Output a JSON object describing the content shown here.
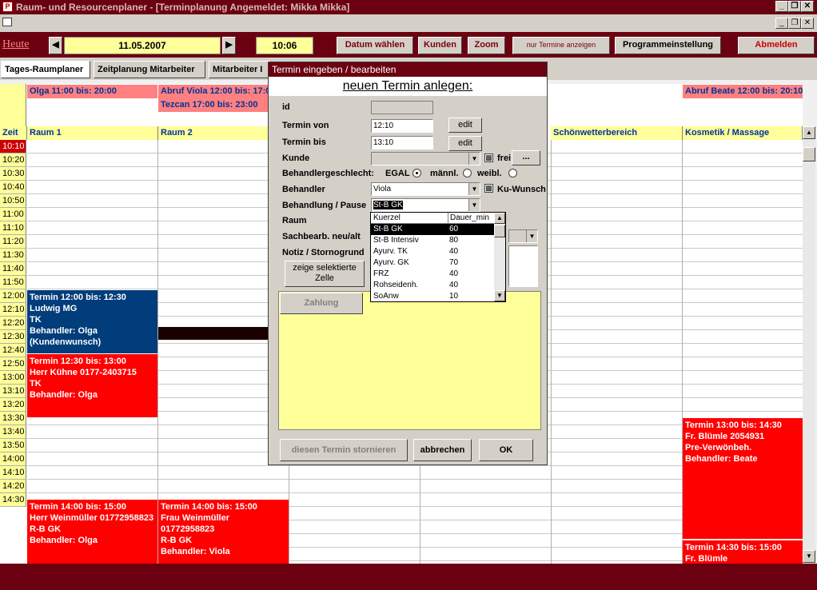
{
  "window": {
    "title": "Raum- und Resourcenplaner - [Terminplanung Angemeldet: Mikka Mikka]"
  },
  "toolbar": {
    "heute": "Heute",
    "date": "11.05.2007",
    "time": "10:06",
    "datum_waehlen": "Datum wählen",
    "kunden": "Kunden",
    "zoom": "Zoom",
    "nur_termine": "nur Termine anzeigen",
    "programmeinstellung": "Programmeinstellung",
    "abmelden": "Abmelden"
  },
  "tabs": [
    "Tages-Raumplaner",
    "Zeitplanung Mitarbeiter",
    "Mitarbeiter I"
  ],
  "top_rows": {
    "olga": "Olga 11:00 bis: 20:00",
    "viola": "Abruf Viola 12:00 bis: 17:00",
    "tezcan": "Tezcan 17:00 bis: 23:00",
    "beate": "Abruf Beate 12:00 bis: 20:10"
  },
  "columns": {
    "zeit": "Zeit",
    "raum1": "Raum 1",
    "raum2": "Raum 2",
    "schoen": "Schönwetterbereich",
    "kosmetik": "Kosmetik / Massage"
  },
  "times": [
    "10:10",
    "10:20",
    "10:30",
    "10:40",
    "10:50",
    "11:00",
    "11:10",
    "11:20",
    "11:30",
    "11:40",
    "11:50",
    "12:00",
    "12:10",
    "12:20",
    "12:30",
    "12:40",
    "12:50",
    "13:00",
    "13:10",
    "13:20",
    "13:30",
    "13:40",
    "13:50",
    "14:00",
    "14:10",
    "14:20",
    "14:30"
  ],
  "appointments": {
    "a1": "Termin 12:00 bis: 12:30\nLudwig MG\nTK\nBehandler: Olga\n(Kundenwunsch)",
    "a2": "Termin 12:30 bis: 13:00\nHerr Kühne 0177-2403715\nTK\nBehandler: Olga",
    "a3": "Termin 14:00 bis: 15:00\nHerr Weinmüller 01772958823\nR-B GK\nBehandler: Olga",
    "a4": "Termin 14:00 bis: 15:00\nFrau Weinmüller\n01772958823\nR-B GK\nBehandler: Viola",
    "a5": "Termin 13:00 bis: 14:30\nFr. Blümle 2054931\nPre-Verwönbeh.\nBehandler: Beate",
    "a6": "Termin 14:30 bis: 15:00\nFr. Blümle"
  },
  "dialog": {
    "title": "Termin eingeben / bearbeiten",
    "heading": "neuen Termin anlegen:",
    "id": "id",
    "von": "Termin von",
    "von_val": "12:10",
    "bis": "Termin bis",
    "bis_val": "13:10",
    "edit": "edit",
    "kunde": "Kunde",
    "frei": "frei",
    "dots": "...",
    "geschlecht": "Behandlergeschlecht:",
    "egal": "EGAL",
    "maennl": "männl.",
    "weibl": "weibl.",
    "behandler": "Behandler",
    "behandler_val": "Viola",
    "kuwunsch": "Ku-Wunsch",
    "behandlung": "Behandlung / Pause",
    "behandlung_val": "St-B GK",
    "raum": "Raum",
    "sachbearb": "Sachbearb. neu/alt",
    "notiz": "Notiz / Stornogrund",
    "zeige": "zeige selektierte Zelle",
    "zahlung": "Zahlung",
    "stornieren": "diesen Termin stornieren",
    "abbrechen": "abbrechen",
    "ok": "OK"
  },
  "dropdown": {
    "h1": "Kuerzel",
    "h2": "Dauer_min",
    "rows": [
      [
        "St-B GK",
        "60"
      ],
      [
        "St-B Intensiv",
        "80"
      ],
      [
        "Ayurv. TK",
        "40"
      ],
      [
        "Ayurv. GK",
        "70"
      ],
      [
        "FRZ",
        "40"
      ],
      [
        "Rohseidenh.",
        "40"
      ],
      [
        "SoAnw",
        "10"
      ]
    ]
  }
}
